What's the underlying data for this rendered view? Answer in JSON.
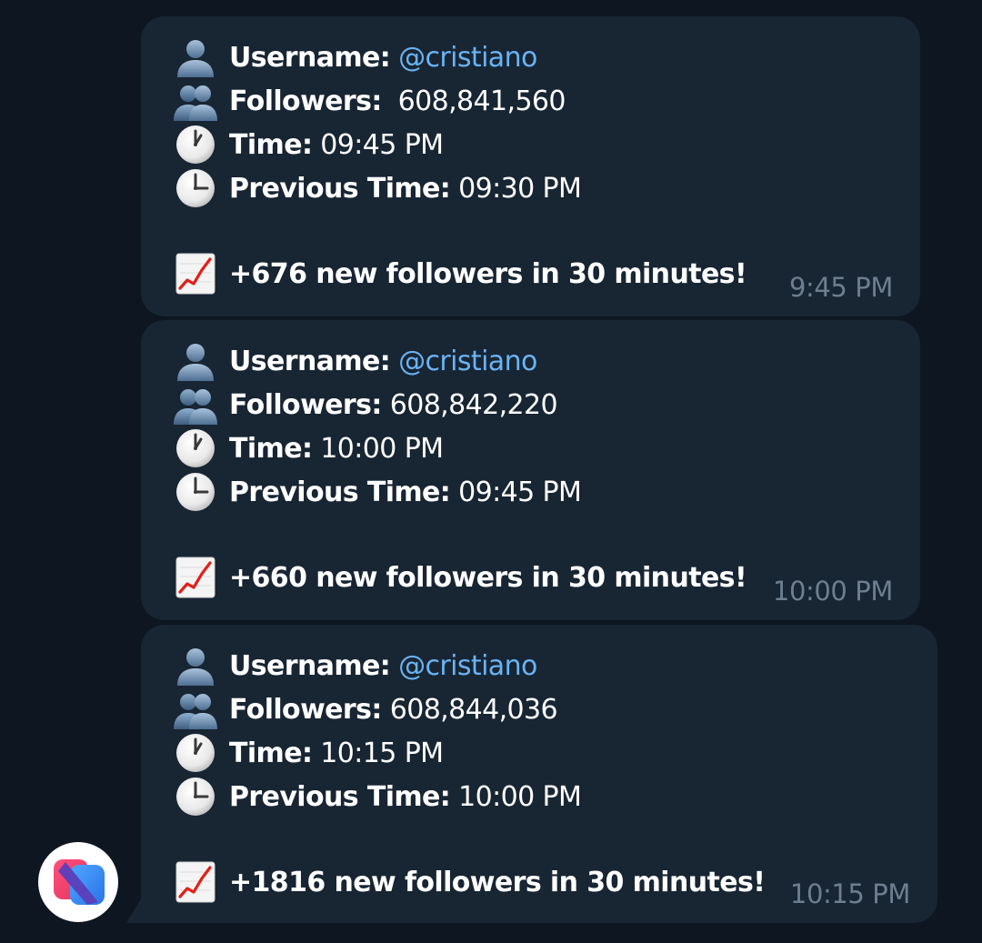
{
  "colors": {
    "background": "#0e1621",
    "bubble": "#182533",
    "text": "#ffffff",
    "link": "#6ab3f3",
    "timestamp": "#6d7f8f"
  },
  "labels": {
    "username": "Username:",
    "followers": "Followers:",
    "time": "Time:",
    "previous_time": "Previous Time:"
  },
  "avatar": {
    "icon": "app-logo-icon"
  },
  "messages": [
    {
      "username": "@cristiano",
      "followers": " 608,841,560",
      "time": "09:45 PM",
      "previous_time": "09:30 PM",
      "summary": "+676 new followers in 30 minutes!",
      "timestamp": "9:45 PM"
    },
    {
      "username": "@cristiano",
      "followers": "608,842,220",
      "time": "10:00 PM",
      "previous_time": "09:45 PM",
      "summary": "+660 new followers in 30 minutes!",
      "timestamp": "10:00 PM"
    },
    {
      "username": "@cristiano",
      "followers": "608,844,036",
      "time": "10:15 PM",
      "previous_time": "10:00 PM",
      "summary": "+1816 new followers in 30 minutes!",
      "timestamp": "10:15 PM"
    }
  ]
}
